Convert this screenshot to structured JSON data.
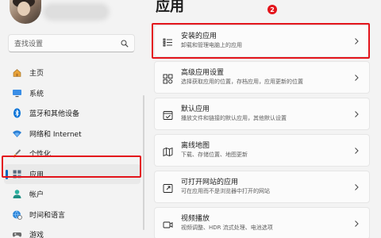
{
  "page": {
    "title": "应用",
    "step_badge": "2"
  },
  "search": {
    "placeholder": "查找设置"
  },
  "sidebar": {
    "items": [
      {
        "label": "主页",
        "icon": "home-icon"
      },
      {
        "label": "系统",
        "icon": "monitor-icon"
      },
      {
        "label": "蓝牙和其他设备",
        "icon": "bluetooth-icon"
      },
      {
        "label": "网络和 Internet",
        "icon": "wifi-icon"
      },
      {
        "label": "个性化",
        "icon": "brush-icon"
      },
      {
        "label": "应用",
        "icon": "apps-icon",
        "active": true
      },
      {
        "label": "帐户",
        "icon": "person-icon"
      },
      {
        "label": "时间和语言",
        "icon": "globe-clock-icon"
      },
      {
        "label": "游戏",
        "icon": "gamepad-icon"
      }
    ]
  },
  "cards": [
    {
      "title": "安装的应用",
      "subtitle": "卸载和管理电脑上的应用",
      "icon": "list-icon"
    },
    {
      "title": "高级应用设置",
      "subtitle": "选择获取应用的位置，存档应用，应用更新的位置",
      "icon": "advanced-apps-icon"
    },
    {
      "title": "默认应用",
      "subtitle": "播放文件和链接的默认应用，其他默认设置",
      "icon": "default-apps-icon"
    },
    {
      "title": "离线地图",
      "subtitle": "下载、存储位置、地图更新",
      "icon": "map-icon"
    },
    {
      "title": "可打开网站的应用",
      "subtitle": "可在应用而不是浏览器中打开的网站",
      "icon": "open-web-icon"
    },
    {
      "title": "视频播放",
      "subtitle": "视频调整、HDR 流式处理、电池选项",
      "icon": "video-icon"
    }
  ],
  "colors": {
    "highlight": "#e3141b",
    "accent": "#0067c0"
  }
}
